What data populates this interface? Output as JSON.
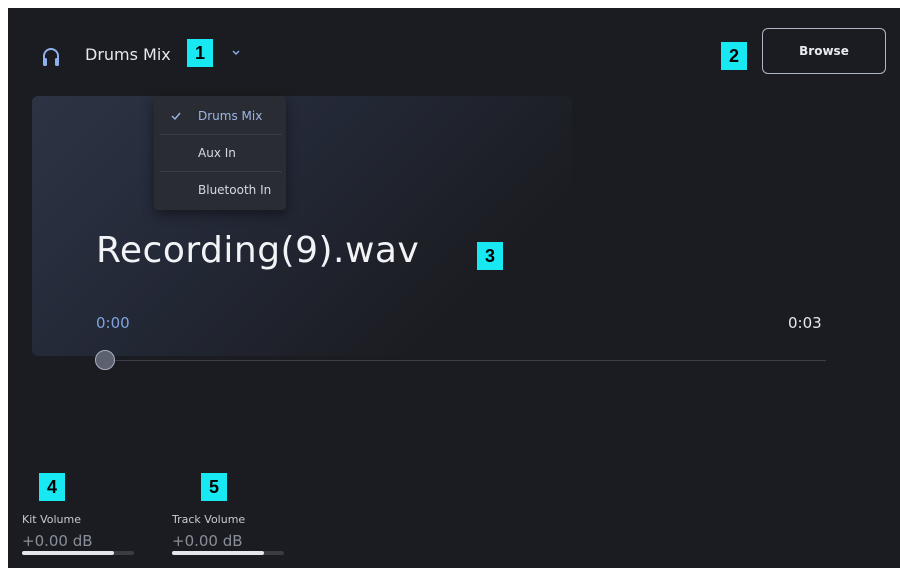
{
  "header": {
    "source_label": "Drums Mix",
    "browse_label": "Browse"
  },
  "badges": [
    "1",
    "2",
    "3",
    "4",
    "5"
  ],
  "source_menu": {
    "items": [
      {
        "label": "Drums Mix",
        "selected": true
      },
      {
        "label": "Aux In",
        "selected": false
      },
      {
        "label": "Bluetooth In",
        "selected": false
      }
    ]
  },
  "player": {
    "title": "Recording(9).wav",
    "current_time": "0:00",
    "total_time": "0:03",
    "progress": 0
  },
  "volumes": {
    "kit": {
      "label": "Kit Volume",
      "value": "+0.00 dB",
      "level": 0.82
    },
    "track": {
      "label": "Track Volume",
      "value": "+0.00 dB",
      "level": 0.82
    }
  },
  "colors": {
    "background": "#1b1c21",
    "accent": "#7fa2de",
    "badge": "#18e8f2"
  },
  "icons": {
    "source": "headphones-icon",
    "dropdown": "chevron-down-icon",
    "selected": "check-icon"
  }
}
